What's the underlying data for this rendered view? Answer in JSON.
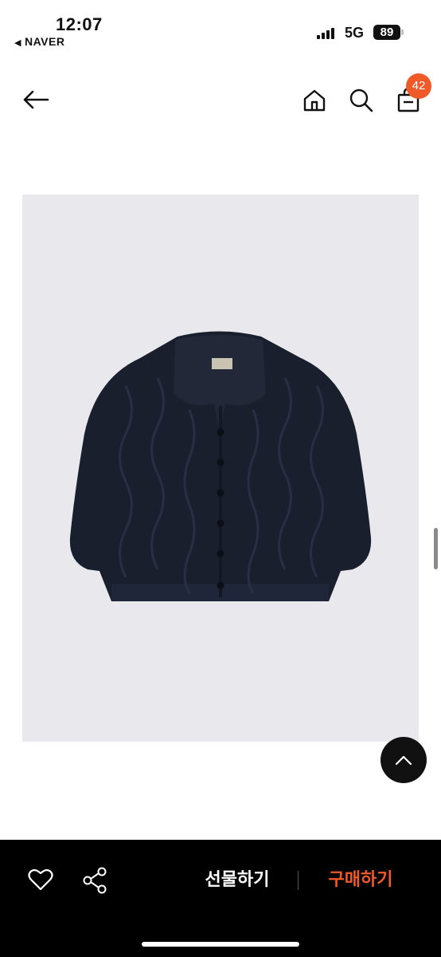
{
  "status_bar": {
    "time": "12:07",
    "back_app": "NAVER",
    "network": "5G",
    "battery": "89"
  },
  "nav": {
    "back_icon": "arrow-left-icon",
    "home_icon": "home-icon",
    "search_icon": "search-icon",
    "cart_icon": "shopping-bag-icon",
    "cart_count": "42"
  },
  "product": {
    "image_icon": "cardigan-product-image",
    "garment_color": "#1a1f2e",
    "background": "#e8e8ed"
  },
  "bottom_bar": {
    "wish_icon": "heart-icon",
    "share_icon": "share-icon",
    "gift_label": "선물하기",
    "buy_label": "구매하기"
  },
  "colors": {
    "accent": "#f05a28",
    "bar_bg": "#000000"
  }
}
